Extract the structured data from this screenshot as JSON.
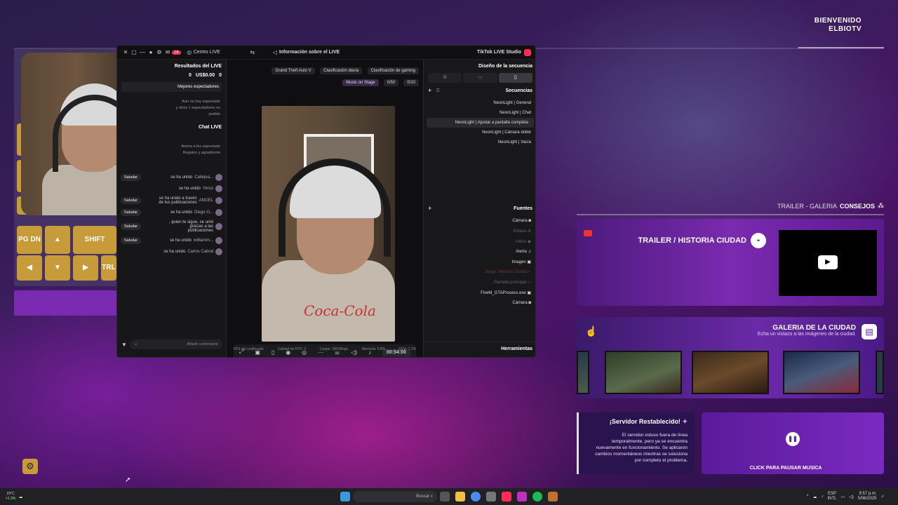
{
  "welcome": {
    "line1": "BIENVENIDO",
    "line2": "ELBIOTV"
  },
  "keyboard": {
    "keys": [
      "PG DN",
      "▲",
      "SHIFT",
      "◀",
      "▼",
      "▶",
      "TRL"
    ]
  },
  "studio": {
    "title": "TikTok LIVE Studio",
    "tab_info": "Información sobre el LIVE",
    "tab_center": "Centro LIVE",
    "badge": "28",
    "left": {
      "results_title": "Resultados del LIVE",
      "stat_gifts": "0",
      "stat_usd": "US$0.00",
      "stat_viewers": "0",
      "best_viewers": "Mejores espectadores",
      "no_viewers": "Aún no hay espectado",
      "viewers_line": "y otros 1 espectadores no",
      "viewers_line2": "podido",
      "chat_title": "Chat LIVE",
      "chat_invite": "Anima a los espectado",
      "chat_invite2": "Regalos y agradécele",
      "chat_messages": [
        {
          "user": "Callejea...",
          "text": "se ha unido",
          "btn": "Saludar"
        },
        {
          "user": "Yeruz",
          "text": "se ha unido",
          "btn": ""
        },
        {
          "user": "ANGEL",
          "text": "se ha unido a través de tus publicaciones",
          "btn": "Saludar"
        },
        {
          "user": "Diego O...",
          "text": "se ha unido",
          "btn": "Saludar"
        },
        {
          "user": "",
          "text": ", quien te sigue, se unió gracias a las publicaciones",
          "btn": "Saludar"
        },
        {
          "user": "williamm...",
          "text": "se ha unido",
          "btn": "Saludar"
        },
        {
          "user": "Carlos Cabral",
          "text": "se ha unido",
          "btn": ""
        }
      ],
      "comment_placeholder": "Añadir comentario"
    },
    "mid": {
      "pill_gta": "Grand Theft Auto V",
      "pill_daily": "Clasificación diaria",
      "pill_gaming": "Clasificación de gaming",
      "goal1": "0/10",
      "goal2": "0/50",
      "goal_label": "Music on Stage",
      "timer": "00:54:00",
      "status_cpu": "CPU: 7.2%",
      "status_mem": "Memoria: 0.8%",
      "status_bitrate": "Cargar: 3853Kbps",
      "status_fps": "Calidad de FPS: 0",
      "status_drop": "FPS del codificador"
    },
    "right": {
      "design_title": "Diseño de la secuencia",
      "sequences_title": "Secuencias",
      "sequences": [
        "NeonLight | General",
        "NeonLight | Chat",
        "NeonLight | Ajustar a pantalla completa",
        "NeonLight | Cámara doble",
        "NeonLight | Vacía"
      ],
      "sources_title": "Fuentes",
      "sources": [
        "Cámara",
        "Enlace",
        "Vídeo",
        "Alerta",
        "Imagen",
        "Juego: Historia Ciudad",
        "Pantalla principal",
        "FiveM_GTAProcess.exe",
        "Cámara"
      ],
      "tools_title": "Herramientas"
    }
  },
  "consejos": {
    "label": "CONSEJOS",
    "tail": "TRAILER - GALERIA"
  },
  "trailer": {
    "title": "TRAILER / HISTORIA CIUDAD"
  },
  "galeria": {
    "title": "GALERIA DE LA CIUDAD",
    "subtitle": "Echa un vistazo a las imágenes de la ciudad."
  },
  "server": {
    "title": "¡Servidor Restablecido!",
    "body": "El servidor estuvo fuera de línea temporalmente, pero ya se encuentra nuevamente en funcionamiento. Se aplicaron cambios momentáneos mientras se soluciona por completo el problema."
  },
  "music": {
    "label": "CLICK PARA PAUSAR MUSICA"
  },
  "taskbar": {
    "search": "Buscar",
    "temp": "23°C",
    "temp_sub": "+1.3%",
    "lang": "ESP",
    "lang_sub": "INTL",
    "time": "9:57 p.m.",
    "date": "5/06/2025"
  },
  "colors": {
    "accent_gold": "#c79a3a",
    "accent_purple": "#7a2ab0",
    "tiktok_red": "#fe2c55"
  }
}
